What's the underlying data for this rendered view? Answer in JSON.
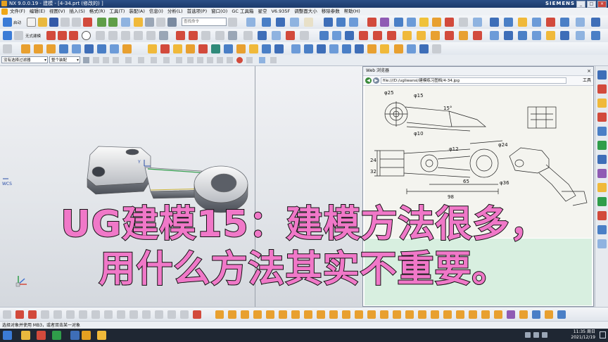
{
  "window": {
    "title": "NX 9.0.0.19 - 建模 - [4-34.prt (修改的) ]",
    "brand": "SIEMENS",
    "controls": [
      "_",
      "□",
      "×"
    ]
  },
  "menu": {
    "items": [
      "文件(F)",
      "编辑(E)",
      "视图(V)",
      "插入(S)",
      "格式(R)",
      "工具(T)",
      "装配(A)",
      "信息(I)",
      "分析(L)",
      "首选项(P)",
      "窗口(O)",
      "GC 工具箱",
      "星空",
      "V6.935F",
      "调整面大小",
      "移除参数",
      "帮助(H)"
    ]
  },
  "toolbar": {
    "start_label": "启动",
    "history_label": "无式建模",
    "command_search_placeholder": "查找命令"
  },
  "selection": {
    "filter": "没有选择过滤器",
    "scope": "整个装配"
  },
  "browser": {
    "title": "Web 浏览器",
    "close": "×",
    "back": "◀",
    "forward": "▶",
    "url": "file:///D:/ugliwansi/建模练习图档/4-34.jpg",
    "tools_label": "工具"
  },
  "drawing": {
    "dims": [
      "φ25",
      "φ15",
      "15°",
      "φ10",
      "φ12",
      "φ24",
      "φ36",
      "65",
      "98",
      "24",
      "32"
    ]
  },
  "caption": {
    "line1": "UG建模15：建模方法很多，",
    "line2": "用什么方法其实不重要。"
  },
  "status": {
    "prompt": "选择对象并使用 MB3，或者双击某一对象"
  },
  "taskbar": {
    "time": "11:35 周日",
    "date": "2021/12/19"
  },
  "workspace": {
    "wcs_label": "WCS"
  },
  "colors": {
    "caption_fill": "#f078c8",
    "caption_stroke": "#111111",
    "titlebar": "#2b4f86",
    "background": "#dde3ea"
  }
}
